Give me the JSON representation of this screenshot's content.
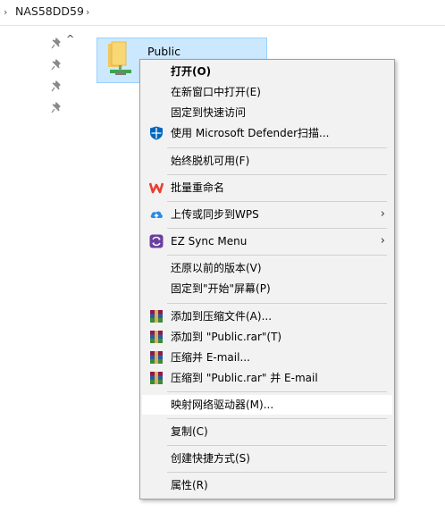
{
  "address_bar": {
    "arrow_left": "›",
    "crumb": "NAS58DD59",
    "arrow_right": "›"
  },
  "nav_pane": {
    "collapse_glyph": "^"
  },
  "file": {
    "name": "Public"
  },
  "menu": {
    "open": "打开(O)",
    "open_new_window": "在新窗口中打开(E)",
    "pin_quick_access": "固定到快速访问",
    "defender_scan": "使用 Microsoft Defender扫描...",
    "always_offline": "始终脱机可用(F)",
    "batch_rename": "批量重命名",
    "upload_wps": "上传或同步到WPS",
    "ez_sync": "EZ Sync Menu",
    "restore_previous": "还原以前的版本(V)",
    "pin_start": "固定到\"开始\"屏幕(P)",
    "add_archive": "添加到压缩文件(A)...",
    "add_public_rar": "添加到 \"Public.rar\"(T)",
    "compress_email": "压缩并 E-mail...",
    "compress_rar_email": "压缩到 \"Public.rar\" 并 E-mail",
    "map_drive": "映射网络驱动器(M)...",
    "copy": "复制(C)",
    "create_shortcut": "创建快捷方式(S)",
    "properties": "属性(R)",
    "submenu_arrow": "›"
  },
  "colors": {
    "selection_bg": "#cce8ff",
    "selection_border": "#99d1ff",
    "menu_bg": "#f2f2f2",
    "menu_hover": "#ffffff",
    "defender_blue": "#0067c0",
    "wps_red": "#e8402f",
    "ez_purple": "#6b3fa0"
  }
}
